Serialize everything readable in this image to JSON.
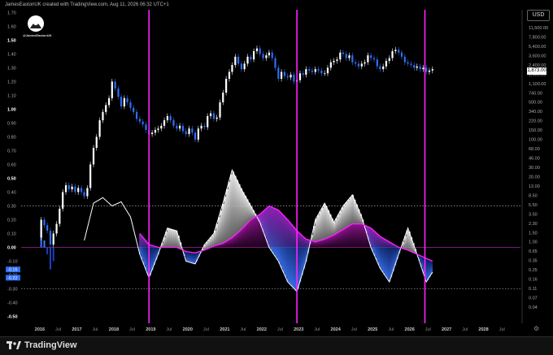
{
  "header": {
    "attribution": "JamesEastonUK created with TradingView.com, Aug 11, 2026 06:32 UTC+1"
  },
  "currency_button": "USD",
  "avatar_handle": "@JamesEastonUK",
  "price_flag": "1,873.00",
  "footer": {
    "brand": "TradingView"
  },
  "colors": {
    "magenta": "#ff22ff",
    "blue": "#2f6df5",
    "white": "#ffffff",
    "purple_divider": "#7a1a7a"
  },
  "chart_data": {
    "type": "line",
    "x_ticks": [
      "2016",
      "Jul",
      "2017",
      "Jul",
      "2018",
      "Jul",
      "2019",
      "Jul",
      "2020",
      "Jul",
      "2021",
      "Jul",
      "2022",
      "Jul",
      "2023",
      "Jul",
      "2024",
      "Jul",
      "2025",
      "Jul",
      "2026",
      "Jul",
      "2027",
      "Jul",
      "2028",
      "Jul"
    ],
    "left_axis_labels": [
      "1.70",
      "1.60",
      "1.50",
      "1.40",
      "1.30",
      "1.20",
      "1.10",
      "1.00",
      "0.90",
      "0.80",
      "0.70",
      "0.60",
      "0.50",
      "0.40",
      "0.30",
      "0.20",
      "0.10",
      "0.00",
      "-0.10",
      "-0.20",
      "-0.30",
      "-0.40",
      "-0.50"
    ],
    "left_axis_ticks": [
      1.7,
      1.6,
      1.5,
      1.4,
      1.3,
      1.2,
      1.1,
      1.0,
      0.9,
      0.8,
      0.7,
      0.6,
      0.5,
      0.4,
      0.3,
      0.2,
      0.1,
      0.0,
      -0.1,
      -0.2,
      -0.3,
      -0.4,
      -0.5
    ],
    "left_axis_bold": [
      "1.50",
      "1.00",
      "0.50",
      "0.00",
      "-0.50"
    ],
    "left_axis_flags": [
      {
        "label": "-0.16",
        "value": -0.16
      },
      {
        "label": "-0.22",
        "value": -0.22
      }
    ],
    "right_axis_labels": [
      "11,500.00",
      "7,800.00",
      "5,400.00",
      "3,600.00",
      "2,400.00",
      "1,600.00",
      "1,100.00",
      "740.00",
      "500.00",
      "340.00",
      "220.00",
      "150.00",
      "100.00",
      "68.00",
      "46.00",
      "30.00",
      "20.00",
      "13.00",
      "8.50",
      "5.50",
      "3.50",
      "2.30",
      "1.50",
      "1.00",
      "0.65",
      "0.35",
      "0.25",
      "0.16",
      "0.11",
      "0.07",
      "0.04"
    ],
    "reference_lines": [
      0.3,
      0.0,
      -0.3
    ],
    "vertical_markers": [
      "2018-12-15",
      "2022-12-15",
      "2026-06-01"
    ],
    "price_candles": [
      {
        "t": "2016-01",
        "o": 0.07,
        "c": 0.2
      },
      {
        "t": "2016-02",
        "o": 0.2,
        "c": 0.16
      },
      {
        "t": "2016-03",
        "o": 0.16,
        "c": 0.12
      },
      {
        "t": "2016-04",
        "o": 0.12,
        "c": 0.02
      },
      {
        "t": "2016-05",
        "o": 0.02,
        "c": 0.1
      },
      {
        "t": "2016-06",
        "o": 0.1,
        "c": 0.17
      },
      {
        "t": "2016-07",
        "o": 0.17,
        "c": 0.28
      },
      {
        "t": "2016-08",
        "o": 0.28,
        "c": 0.4
      },
      {
        "t": "2016-09",
        "o": 0.4,
        "c": 0.45
      },
      {
        "t": "2016-10",
        "o": 0.45,
        "c": 0.42
      },
      {
        "t": "2016-11",
        "o": 0.42,
        "c": 0.44
      },
      {
        "t": "2016-12",
        "o": 0.44,
        "c": 0.4
      },
      {
        "t": "2017-01",
        "o": 0.4,
        "c": 0.43
      },
      {
        "t": "2017-02",
        "o": 0.43,
        "c": 0.4
      },
      {
        "t": "2017-03",
        "o": 0.4,
        "c": 0.37
      },
      {
        "t": "2017-04",
        "o": 0.37,
        "c": 0.43
      },
      {
        "t": "2017-05",
        "o": 0.43,
        "c": 0.6
      },
      {
        "t": "2017-06",
        "o": 0.6,
        "c": 0.72
      },
      {
        "t": "2017-07",
        "o": 0.72,
        "c": 0.8
      },
      {
        "t": "2017-08",
        "o": 0.8,
        "c": 0.92
      },
      {
        "t": "2017-09",
        "o": 0.92,
        "c": 0.98
      },
      {
        "t": "2017-10",
        "o": 0.98,
        "c": 1.03
      },
      {
        "t": "2017-11",
        "o": 1.03,
        "c": 1.08
      },
      {
        "t": "2017-12",
        "o": 1.08,
        "c": 1.2
      },
      {
        "t": "2018-01",
        "o": 1.2,
        "c": 1.15
      },
      {
        "t": "2018-02",
        "o": 1.15,
        "c": 1.09
      },
      {
        "t": "2018-03",
        "o": 1.09,
        "c": 1.02
      },
      {
        "t": "2018-04",
        "o": 1.02,
        "c": 1.08
      },
      {
        "t": "2018-05",
        "o": 1.08,
        "c": 1.05
      },
      {
        "t": "2018-06",
        "o": 1.05,
        "c": 1.01
      },
      {
        "t": "2018-07",
        "o": 1.01,
        "c": 0.98
      },
      {
        "t": "2018-08",
        "o": 0.98,
        "c": 0.93
      },
      {
        "t": "2018-09",
        "o": 0.93,
        "c": 0.91
      },
      {
        "t": "2018-10",
        "o": 0.91,
        "c": 0.89
      },
      {
        "t": "2018-11",
        "o": 0.89,
        "c": 0.85
      },
      {
        "t": "2018-12",
        "o": 0.85,
        "c": 0.82
      },
      {
        "t": "2019-01",
        "o": 0.82,
        "c": 0.83
      },
      {
        "t": "2019-02",
        "o": 0.83,
        "c": 0.85
      },
      {
        "t": "2019-03",
        "o": 0.85,
        "c": 0.86
      },
      {
        "t": "2019-04",
        "o": 0.86,
        "c": 0.88
      },
      {
        "t": "2019-05",
        "o": 0.88,
        "c": 0.92
      },
      {
        "t": "2019-06",
        "o": 0.92,
        "c": 0.95
      },
      {
        "t": "2019-07",
        "o": 0.95,
        "c": 0.92
      },
      {
        "t": "2019-08",
        "o": 0.92,
        "c": 0.88
      },
      {
        "t": "2019-09",
        "o": 0.88,
        "c": 0.86
      },
      {
        "t": "2019-10",
        "o": 0.86,
        "c": 0.88
      },
      {
        "t": "2019-11",
        "o": 0.88,
        "c": 0.84
      },
      {
        "t": "2019-12",
        "o": 0.84,
        "c": 0.82
      },
      {
        "t": "2020-01",
        "o": 0.82,
        "c": 0.86
      },
      {
        "t": "2020-02",
        "o": 0.86,
        "c": 0.83
      },
      {
        "t": "2020-03",
        "o": 0.83,
        "c": 0.78
      },
      {
        "t": "2020-04",
        "o": 0.78,
        "c": 0.86
      },
      {
        "t": "2020-05",
        "o": 0.86,
        "c": 0.88
      },
      {
        "t": "2020-06",
        "o": 0.88,
        "c": 0.87
      },
      {
        "t": "2020-07",
        "o": 0.87,
        "c": 0.95
      },
      {
        "t": "2020-08",
        "o": 0.95,
        "c": 0.97
      },
      {
        "t": "2020-09",
        "o": 0.97,
        "c": 0.93
      },
      {
        "t": "2020-10",
        "o": 0.93,
        "c": 0.94
      },
      {
        "t": "2020-11",
        "o": 0.94,
        "c": 1.05
      },
      {
        "t": "2020-12",
        "o": 1.05,
        "c": 1.12
      },
      {
        "t": "2021-01",
        "o": 1.12,
        "c": 1.22
      },
      {
        "t": "2021-02",
        "o": 1.22,
        "c": 1.27
      },
      {
        "t": "2021-03",
        "o": 1.27,
        "c": 1.32
      },
      {
        "t": "2021-04",
        "o": 1.32,
        "c": 1.38
      },
      {
        "t": "2021-05",
        "o": 1.38,
        "c": 1.33
      },
      {
        "t": "2021-06",
        "o": 1.33,
        "c": 1.29
      },
      {
        "t": "2021-07",
        "o": 1.29,
        "c": 1.33
      },
      {
        "t": "2021-08",
        "o": 1.33,
        "c": 1.38
      },
      {
        "t": "2021-09",
        "o": 1.38,
        "c": 1.36
      },
      {
        "t": "2021-10",
        "o": 1.36,
        "c": 1.42
      },
      {
        "t": "2021-11",
        "o": 1.42,
        "c": 1.44
      },
      {
        "t": "2021-12",
        "o": 1.44,
        "c": 1.4
      },
      {
        "t": "2022-01",
        "o": 1.4,
        "c": 1.37
      },
      {
        "t": "2022-02",
        "o": 1.37,
        "c": 1.39
      },
      {
        "t": "2022-03",
        "o": 1.39,
        "c": 1.41
      },
      {
        "t": "2022-04",
        "o": 1.41,
        "c": 1.37
      },
      {
        "t": "2022-05",
        "o": 1.37,
        "c": 1.3
      },
      {
        "t": "2022-06",
        "o": 1.3,
        "c": 1.22
      },
      {
        "t": "2022-07",
        "o": 1.22,
        "c": 1.27
      },
      {
        "t": "2022-08",
        "o": 1.27,
        "c": 1.24
      },
      {
        "t": "2022-09",
        "o": 1.24,
        "c": 1.23
      },
      {
        "t": "2022-10",
        "o": 1.23,
        "c": 1.25
      },
      {
        "t": "2022-11",
        "o": 1.25,
        "c": 1.2
      },
      {
        "t": "2022-12",
        "o": 1.2,
        "c": 1.21
      },
      {
        "t": "2023-01",
        "o": 1.21,
        "c": 1.26
      },
      {
        "t": "2023-02",
        "o": 1.26,
        "c": 1.25
      },
      {
        "t": "2023-03",
        "o": 1.25,
        "c": 1.29
      },
      {
        "t": "2023-04",
        "o": 1.29,
        "c": 1.28
      },
      {
        "t": "2023-05",
        "o": 1.28,
        "c": 1.27
      },
      {
        "t": "2023-06",
        "o": 1.27,
        "c": 1.29
      },
      {
        "t": "2023-07",
        "o": 1.29,
        "c": 1.28
      },
      {
        "t": "2023-08",
        "o": 1.28,
        "c": 1.26
      },
      {
        "t": "2023-09",
        "o": 1.26,
        "c": 1.26
      },
      {
        "t": "2023-10",
        "o": 1.26,
        "c": 1.3
      },
      {
        "t": "2023-11",
        "o": 1.3,
        "c": 1.34
      },
      {
        "t": "2023-12",
        "o": 1.34,
        "c": 1.35
      },
      {
        "t": "2024-01",
        "o": 1.35,
        "c": 1.36
      },
      {
        "t": "2024-02",
        "o": 1.36,
        "c": 1.41
      },
      {
        "t": "2024-03",
        "o": 1.41,
        "c": 1.4
      },
      {
        "t": "2024-04",
        "o": 1.4,
        "c": 1.37
      },
      {
        "t": "2024-05",
        "o": 1.37,
        "c": 1.39
      },
      {
        "t": "2024-06",
        "o": 1.39,
        "c": 1.34
      },
      {
        "t": "2024-07",
        "o": 1.34,
        "c": 1.33
      },
      {
        "t": "2024-08",
        "o": 1.33,
        "c": 1.31
      },
      {
        "t": "2024-09",
        "o": 1.31,
        "c": 1.33
      },
      {
        "t": "2024-10",
        "o": 1.33,
        "c": 1.34
      },
      {
        "t": "2024-11",
        "o": 1.34,
        "c": 1.39
      },
      {
        "t": "2024-12",
        "o": 1.39,
        "c": 1.37
      },
      {
        "t": "2025-01",
        "o": 1.37,
        "c": 1.36
      },
      {
        "t": "2025-02",
        "o": 1.36,
        "c": 1.31
      },
      {
        "t": "2025-03",
        "o": 1.31,
        "c": 1.29
      },
      {
        "t": "2025-04",
        "o": 1.29,
        "c": 1.31
      },
      {
        "t": "2025-05",
        "o": 1.31,
        "c": 1.35
      },
      {
        "t": "2025-06",
        "o": 1.35,
        "c": 1.37
      },
      {
        "t": "2025-07",
        "o": 1.37,
        "c": 1.42
      },
      {
        "t": "2025-08",
        "o": 1.42,
        "c": 1.43
      },
      {
        "t": "2025-09",
        "o": 1.43,
        "c": 1.41
      },
      {
        "t": "2025-10",
        "o": 1.41,
        "c": 1.38
      },
      {
        "t": "2025-11",
        "o": 1.38,
        "c": 1.34
      },
      {
        "t": "2025-12",
        "o": 1.34,
        "c": 1.33
      },
      {
        "t": "2026-01",
        "o": 1.33,
        "c": 1.32
      },
      {
        "t": "2026-02",
        "o": 1.32,
        "c": 1.3
      },
      {
        "t": "2026-03",
        "o": 1.3,
        "c": 1.31
      },
      {
        "t": "2026-04",
        "o": 1.31,
        "c": 1.29
      },
      {
        "t": "2026-05",
        "o": 1.29,
        "c": 1.3
      },
      {
        "t": "2026-06",
        "o": 1.3,
        "c": 1.27
      },
      {
        "t": "2026-07",
        "o": 1.27,
        "c": 1.28
      },
      {
        "t": "2026-08",
        "o": 1.28,
        "c": 1.29
      }
    ],
    "oscillator_white": [
      [
        "2017-03",
        0.05
      ],
      [
        "2017-06",
        0.32
      ],
      [
        "2017-09",
        0.36
      ],
      [
        "2017-12",
        0.3
      ],
      [
        "2018-03",
        0.33
      ],
      [
        "2018-06",
        0.22
      ],
      [
        "2018-09",
        -0.05
      ],
      [
        "2018-12",
        -0.22
      ],
      [
        "2019-03",
        -0.05
      ],
      [
        "2019-06",
        0.14
      ],
      [
        "2019-09",
        0.12
      ],
      [
        "2019-12",
        -0.1
      ],
      [
        "2020-03",
        -0.12
      ],
      [
        "2020-06",
        0.02
      ],
      [
        "2020-09",
        0.1
      ],
      [
        "2020-12",
        0.32
      ],
      [
        "2021-03",
        0.56
      ],
      [
        "2021-06",
        0.42
      ],
      [
        "2021-09",
        0.3
      ],
      [
        "2021-12",
        0.18
      ],
      [
        "2022-03",
        0.0
      ],
      [
        "2022-06",
        -0.1
      ],
      [
        "2022-09",
        -0.25
      ],
      [
        "2022-12",
        -0.32
      ],
      [
        "2023-03",
        -0.1
      ],
      [
        "2023-06",
        0.2
      ],
      [
        "2023-09",
        0.32
      ],
      [
        "2023-12",
        0.18
      ],
      [
        "2024-03",
        0.3
      ],
      [
        "2024-06",
        0.38
      ],
      [
        "2024-09",
        0.22
      ],
      [
        "2024-12",
        0.0
      ],
      [
        "2025-03",
        -0.15
      ],
      [
        "2025-06",
        -0.25
      ],
      [
        "2025-09",
        -0.05
      ],
      [
        "2025-12",
        0.14
      ],
      [
        "2026-03",
        -0.05
      ],
      [
        "2026-06",
        -0.25
      ],
      [
        "2026-08",
        -0.18
      ]
    ],
    "oscillator_signal": [
      [
        "2018-09",
        0.1
      ],
      [
        "2018-12",
        0.02
      ],
      [
        "2019-03",
        0.0
      ],
      [
        "2019-06",
        0.0
      ],
      [
        "2019-09",
        0.0
      ],
      [
        "2019-12",
        -0.03
      ],
      [
        "2020-03",
        -0.04
      ],
      [
        "2020-06",
        -0.02
      ],
      [
        "2020-09",
        0.01
      ],
      [
        "2020-12",
        0.03
      ],
      [
        "2021-03",
        0.07
      ],
      [
        "2021-06",
        0.13
      ],
      [
        "2021-09",
        0.2
      ],
      [
        "2021-12",
        0.24
      ],
      [
        "2022-03",
        0.3
      ],
      [
        "2022-06",
        0.27
      ],
      [
        "2022-09",
        0.2
      ],
      [
        "2022-12",
        0.12
      ],
      [
        "2023-03",
        0.06
      ],
      [
        "2023-06",
        0.04
      ],
      [
        "2023-09",
        0.06
      ],
      [
        "2023-12",
        0.09
      ],
      [
        "2024-03",
        0.13
      ],
      [
        "2024-06",
        0.17
      ],
      [
        "2024-09",
        0.17
      ],
      [
        "2024-12",
        0.14
      ],
      [
        "2025-03",
        0.08
      ],
      [
        "2025-06",
        0.04
      ],
      [
        "2025-09",
        0.0
      ],
      [
        "2025-12",
        -0.02
      ],
      [
        "2026-03",
        -0.05
      ],
      [
        "2026-06",
        -0.08
      ],
      [
        "2026-08",
        -0.1
      ]
    ],
    "early_histogram": [
      [
        "2016-01",
        0.17
      ],
      [
        "2016-02",
        0.05
      ],
      [
        "2016-03",
        -0.05
      ],
      [
        "2016-04",
        -0.16
      ],
      [
        "2016-05",
        -0.1
      ]
    ]
  }
}
